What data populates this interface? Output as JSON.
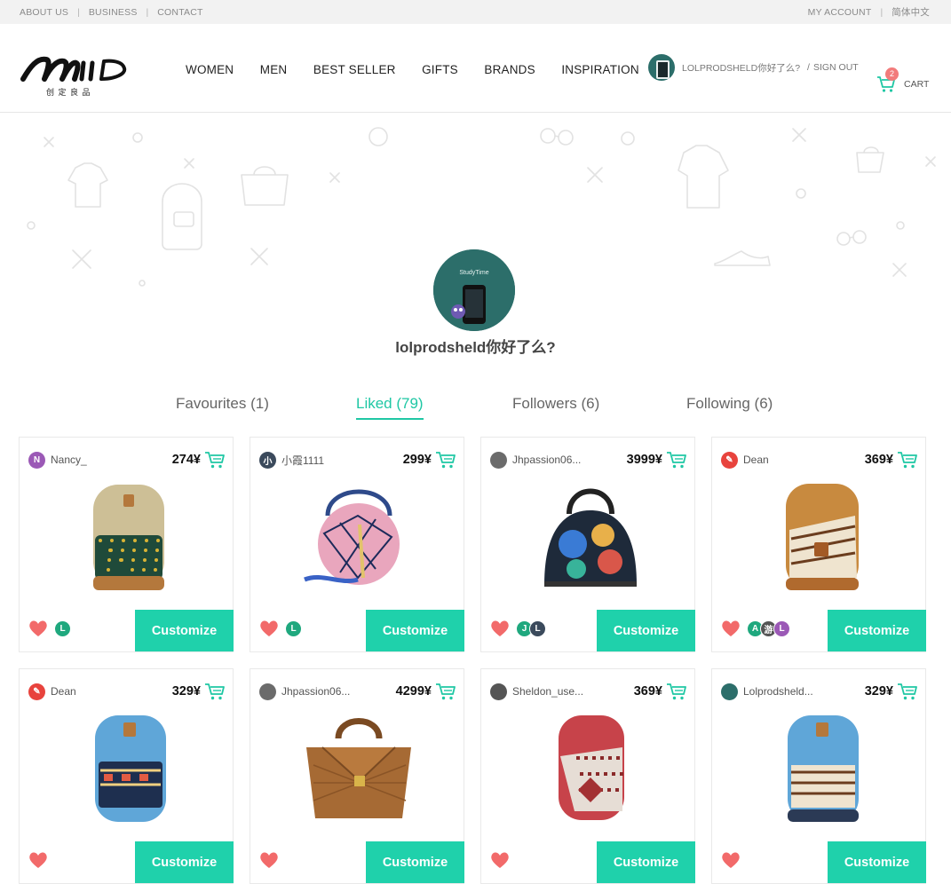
{
  "topbar": {
    "left": [
      "ABOUT US",
      "BUSINESS",
      "CONTACT"
    ],
    "right": [
      "MY ACCOUNT",
      "简体中文"
    ]
  },
  "brand": {
    "logo_text": "MIID",
    "tagline": "创 定 良 品"
  },
  "nav": [
    "WOMEN",
    "MEN",
    "BEST SELLER",
    "GIFTS",
    "BRANDS",
    "INSPIRATION"
  ],
  "user": {
    "name": "LOLPRODSHELD你好了么?",
    "sign_out": "SIGN OUT"
  },
  "cart": {
    "label": "CART",
    "count": "2"
  },
  "profile": {
    "name": "lolprodsheld你好了么?"
  },
  "tabs": [
    "Favourites (1)",
    "Liked (79)",
    "Followers (6)",
    "Following (6)"
  ],
  "active_tab": 1,
  "colors": {
    "accent": "#1fd1ab",
    "heart": "#f26a6a",
    "badge": "#f27b7b"
  },
  "customize_label": "Customize",
  "products": [
    {
      "user": "Nancy_",
      "avatar": "N",
      "avatar_color": "#9b59b6",
      "price": "274¥",
      "image": "backpack-khaki-green",
      "likers": [
        "L"
      ]
    },
    {
      "user": "小霞1111",
      "avatar": "小",
      "avatar_color": "#3b4a5c",
      "price": "299¥",
      "image": "round-bag-pink",
      "likers": [
        "L"
      ]
    },
    {
      "user": "Jhpassion06...",
      "avatar": "",
      "avatar_color": "#6b6b6b",
      "price": "3999¥",
      "image": "dome-bag-floral",
      "likers": [
        "J",
        "L"
      ]
    },
    {
      "user": "Dean",
      "avatar": "✎",
      "avatar_color": "#e8433d",
      "price": "369¥",
      "image": "backpack-tan-tribal",
      "likers": [
        "A",
        "游",
        "L"
      ]
    },
    {
      "user": "Dean",
      "avatar": "✎",
      "avatar_color": "#e8433d",
      "price": "329¥",
      "image": "backpack-blue-tribal",
      "likers": []
    },
    {
      "user": "Jhpassion06...",
      "avatar": "",
      "avatar_color": "#6b6b6b",
      "price": "4299¥",
      "image": "handbag-brown-quilted",
      "likers": []
    },
    {
      "user": "Sheldon_use...",
      "avatar": "",
      "avatar_color": "#555555",
      "price": "369¥",
      "image": "backpack-red-pattern",
      "likers": []
    },
    {
      "user": "Lolprodsheld...",
      "avatar": "",
      "avatar_color": "#2c6e6a",
      "price": "329¥",
      "image": "backpack-blue-stripe",
      "likers": []
    }
  ]
}
